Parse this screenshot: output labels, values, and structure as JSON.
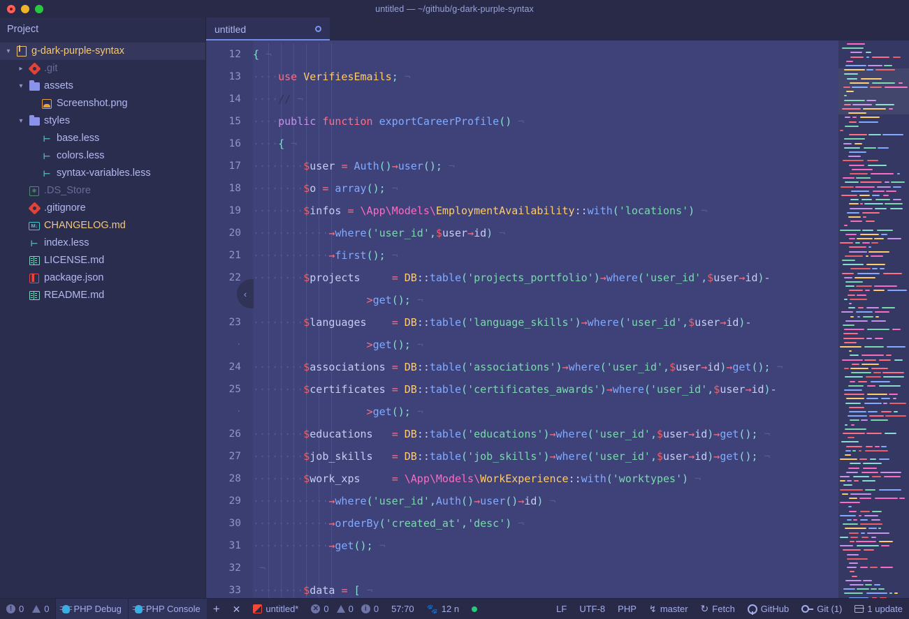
{
  "window": {
    "title": "untitled — ~/github/g-dark-purple-syntax"
  },
  "sidebar": {
    "header": "Project",
    "tree": [
      {
        "label": "g-dark-purple-syntax",
        "icon": "book-icon",
        "twisty": "down",
        "depth": 0,
        "selected": true,
        "style": "yel"
      },
      {
        "label": ".git",
        "icon": "git-icon",
        "twisty": "right",
        "depth": 1,
        "selected": false,
        "style": "dim"
      },
      {
        "label": "assets",
        "icon": "folder-icon",
        "twisty": "down",
        "depth": 1,
        "selected": false,
        "style": "pur"
      },
      {
        "label": "Screenshot.png",
        "icon": "image-icon",
        "twisty": "blank",
        "depth": 2,
        "selected": false,
        "style": "pur"
      },
      {
        "label": "styles",
        "icon": "folder-icon",
        "twisty": "down",
        "depth": 1,
        "selected": false,
        "style": "pur"
      },
      {
        "label": "base.less",
        "icon": "less-icon",
        "twisty": "blank",
        "depth": 2,
        "selected": false,
        "style": "pur"
      },
      {
        "label": "colors.less",
        "icon": "less-icon",
        "twisty": "blank",
        "depth": 2,
        "selected": false,
        "style": "pur"
      },
      {
        "label": "syntax-variables.less",
        "icon": "less-icon",
        "twisty": "blank",
        "depth": 2,
        "selected": false,
        "style": "pur"
      },
      {
        "label": ".DS_Store",
        "icon": "ds-store-icon",
        "twisty": "blank",
        "depth": 1,
        "selected": false,
        "style": "dim"
      },
      {
        "label": ".gitignore",
        "icon": "git-icon",
        "twisty": "blank",
        "depth": 1,
        "selected": false,
        "style": "pur"
      },
      {
        "label": "CHANGELOG.md",
        "icon": "markdown-icon",
        "twisty": "blank",
        "depth": 1,
        "selected": false,
        "style": "yel"
      },
      {
        "label": "index.less",
        "icon": "less-icon",
        "twisty": "blank",
        "depth": 1,
        "selected": false,
        "style": "pur"
      },
      {
        "label": "LICENSE.md",
        "icon": "doc-icon",
        "twisty": "blank",
        "depth": 1,
        "selected": false,
        "style": "pur"
      },
      {
        "label": "package.json",
        "icon": "json-icon",
        "twisty": "blank",
        "depth": 1,
        "selected": false,
        "style": "pur"
      },
      {
        "label": "README.md",
        "icon": "doc-icon",
        "twisty": "blank",
        "depth": 1,
        "selected": false,
        "style": "pur"
      }
    ]
  },
  "tabs": [
    {
      "title": "untitled",
      "modified": true,
      "active": true
    }
  ],
  "editor": {
    "collapse_chevron": "‹",
    "lines": [
      {
        "num": "12",
        "indent": 0,
        "text": "{"
      },
      {
        "num": "13",
        "indent": 2,
        "text": "use VerifiesEmails;"
      },
      {
        "num": "14",
        "indent": 2,
        "text": "//"
      },
      {
        "num": "15",
        "indent": 2,
        "text": "public function exportCareerProfile()"
      },
      {
        "num": "16",
        "indent": 2,
        "text": "{"
      },
      {
        "num": "17",
        "indent": 4,
        "text": "$user = Auth()→user();"
      },
      {
        "num": "18",
        "indent": 4,
        "text": "$o = array();"
      },
      {
        "num": "19",
        "indent": 4,
        "text": "$infos = \\App\\Models\\EmploymentAvailability::with('locations')"
      },
      {
        "num": "20",
        "indent": 6,
        "text": "→where('user_id',$user→id)"
      },
      {
        "num": "21",
        "indent": 6,
        "text": "→first();"
      },
      {
        "num": "22",
        "indent": 4,
        "text": "$projects     = DB::table('projects_portfolio')→where('user_id',$user→id)->get();"
      },
      {
        "num": "23",
        "indent": 4,
        "text": "$languages    = DB::table('language_skills')→where('user_id',$user→id)->get();"
      },
      {
        "num": "24",
        "indent": 4,
        "text": "$associations = DB::table('associations')→where('user_id',$user→id)→get();"
      },
      {
        "num": "25",
        "indent": 4,
        "text": "$certificates = DB::table('certificates_awards')→where('user_id',$user→id)->get();"
      },
      {
        "num": "26",
        "indent": 4,
        "text": "$educations   = DB::table('educations')→where('user_id',$user→id)→get();"
      },
      {
        "num": "27",
        "indent": 4,
        "text": "$job_skills   = DB::table('job_skills')→where('user_id',$user→id)→get();"
      },
      {
        "num": "28",
        "indent": 4,
        "text": "$work_xps     = \\App\\Models\\WorkExperience::with('worktypes')"
      },
      {
        "num": "29",
        "indent": 6,
        "text": "→where('user_id',Auth()→user()→id)"
      },
      {
        "num": "30",
        "indent": 6,
        "text": "→orderBy('created_at','desc')"
      },
      {
        "num": "31",
        "indent": 6,
        "text": "→get();"
      },
      {
        "num": "32",
        "indent": 0,
        "text": ""
      },
      {
        "num": "33",
        "indent": 4,
        "text": "$data = ["
      }
    ]
  },
  "statusbar": {
    "error_count": "0",
    "warning_count": "0",
    "php_debug": "PHP Debug",
    "php_console": "PHP Console",
    "file_name": "untitled*",
    "diag_error": "0",
    "diag_warning": "0",
    "diag_info": "0",
    "cursor_position": "57:70",
    "package_count": "12 n",
    "line_ending": "LF",
    "encoding": "UTF-8",
    "grammar": "PHP",
    "branch": "master",
    "fetch": "Fetch",
    "github": "GitHub",
    "git": "Git (1)",
    "updates": "1 update"
  },
  "colors": {
    "editor_bg": "#3e4279",
    "sidebar_bg": "#2b2d4f",
    "chrome_bg": "#282a47",
    "accent": "#6f8ce8",
    "minimap_bg": "#343862"
  }
}
